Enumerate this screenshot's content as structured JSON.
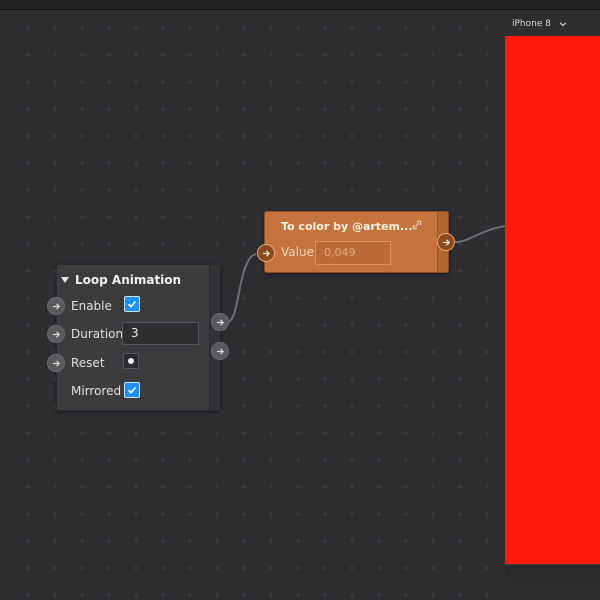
{
  "loop_node": {
    "title": "Loop Animation",
    "enable_label": "Enable",
    "enable_checked": true,
    "duration_label": "Duration",
    "duration_value": "3",
    "reset_label": "Reset",
    "mirrored_label": "Mirrored",
    "mirrored_checked": true
  },
  "color_node": {
    "title": "To color by @artem...",
    "value_label": "Value",
    "value_field": "0,049"
  },
  "preview": {
    "device": "iPhone 8",
    "screen_color": "#ff1a10"
  },
  "colors": {
    "canvas": "#2e2e31",
    "loop_node": "#3c3c3f",
    "color_node": "#c4743c",
    "checkbox_accent": "#1e90ff"
  }
}
